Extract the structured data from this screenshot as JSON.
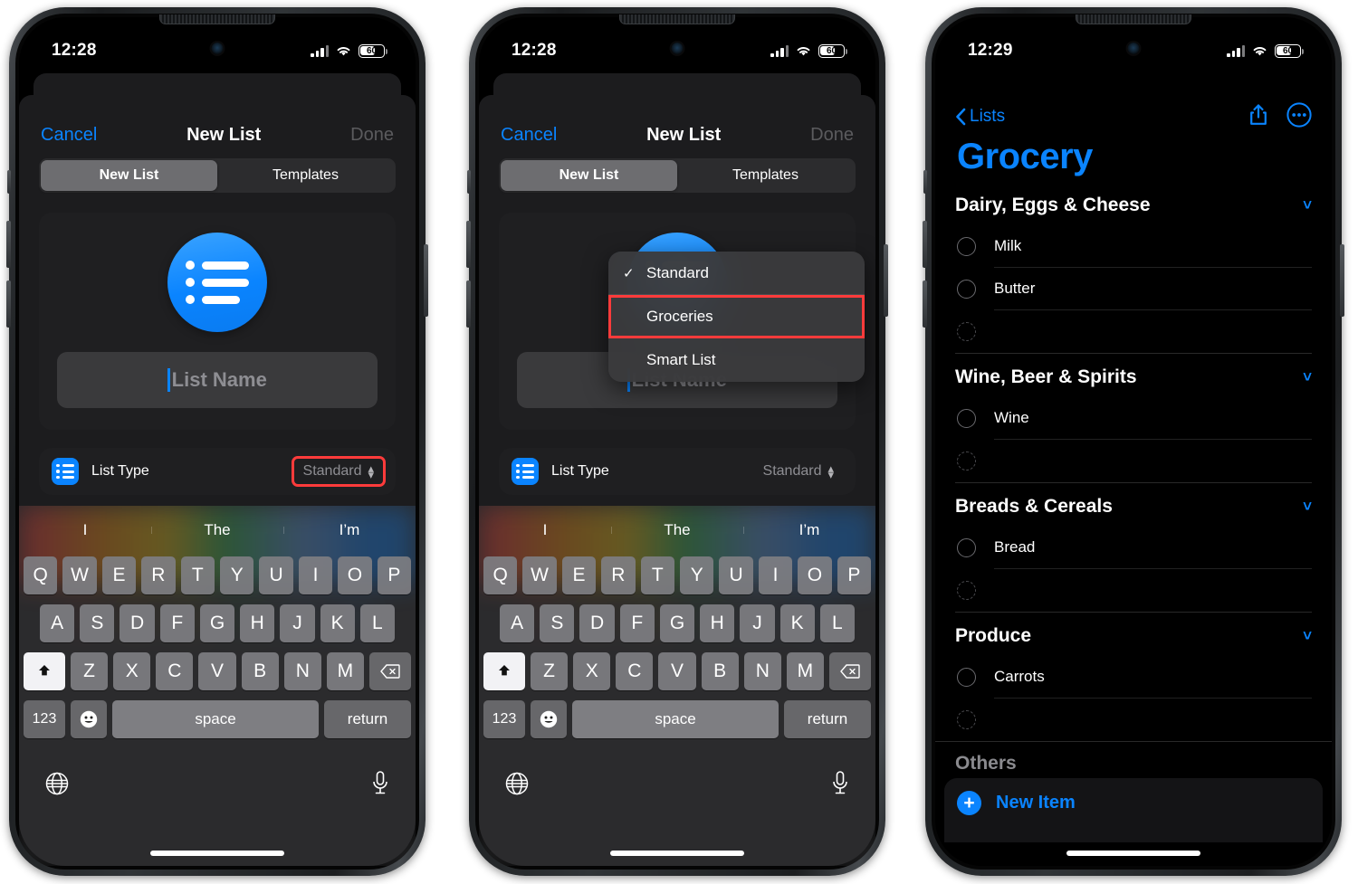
{
  "phones": [
    {
      "status": {
        "time": "12:28",
        "battery": "60"
      },
      "sheet": {
        "cancel": "Cancel",
        "title": "New List",
        "done": "Done",
        "segments": [
          {
            "label": "New List",
            "active": true
          },
          {
            "label": "Templates",
            "active": false
          }
        ],
        "name_placeholder": "List Name",
        "list_type_label": "List Type",
        "list_type_value": "Standard",
        "list_type_highlighted": true
      },
      "swatches": [
        "#ff3b30",
        "#ff9500",
        "#ffd60a",
        "#30d158",
        "#64aaff",
        "#0a84ff"
      ],
      "swatch_selected_index": 5,
      "popup": null
    },
    {
      "status": {
        "time": "12:28",
        "battery": "60"
      },
      "sheet": {
        "cancel": "Cancel",
        "title": "New List",
        "done": "Done",
        "segments": [
          {
            "label": "New List",
            "active": true
          },
          {
            "label": "Templates",
            "active": false
          }
        ],
        "name_placeholder": "List Name",
        "list_type_label": "List Type",
        "list_type_value": "Standard",
        "list_type_highlighted": false
      },
      "swatches": [
        "#ff3b30",
        "#ff9500",
        "#ffd60a",
        "#30d158",
        "#64aaff",
        "#0a84ff"
      ],
      "swatch_selected_index": 5,
      "popup": {
        "items": [
          {
            "label": "Standard",
            "checked": true,
            "highlighted": false
          },
          {
            "label": "Groceries",
            "checked": false,
            "highlighted": true
          },
          {
            "label": "Smart List",
            "checked": false,
            "highlighted": false
          }
        ]
      }
    }
  ],
  "keyboard": {
    "predictions": [
      "I",
      "The",
      "I’m"
    ],
    "row1": [
      "Q",
      "W",
      "E",
      "R",
      "T",
      "Y",
      "U",
      "I",
      "O",
      "P"
    ],
    "row2": [
      "A",
      "S",
      "D",
      "F",
      "G",
      "H",
      "J",
      "K",
      "L"
    ],
    "row3": [
      "Z",
      "X",
      "C",
      "V",
      "B",
      "N",
      "M"
    ],
    "numbers_key": "123",
    "space_key": "space",
    "return_key": "return",
    "shift_icon": "shift-key-icon",
    "delete_icon": "delete-key-icon",
    "emoji_icon": "emoji-key-icon",
    "globe_icon": "globe-icon",
    "mic_icon": "microphone-icon"
  },
  "grocery": {
    "status": {
      "time": "12:29",
      "battery": "60"
    },
    "back_label": "Lists",
    "share_icon": "share-icon",
    "more_icon": "more-options-icon",
    "title": "Grocery",
    "sections": [
      {
        "title": "Dairy, Eggs & Cheese",
        "items": [
          "Milk",
          "Butter"
        ],
        "has_empty_row": true
      },
      {
        "title": "Wine, Beer & Spirits",
        "items": [
          "Wine"
        ],
        "has_empty_row": true
      },
      {
        "title": "Breads & Cereals",
        "items": [
          "Bread"
        ],
        "has_empty_row": true
      },
      {
        "title": "Produce",
        "items": [
          "Carrots"
        ],
        "has_empty_row": true
      }
    ],
    "others_label": "Others",
    "new_item_label": "New Item"
  },
  "colors": {
    "accent": "#0a84ff",
    "highlight": "#ff3b3b",
    "sheet_bg": "#1c1c1e",
    "card_bg": "#1f1f21"
  }
}
